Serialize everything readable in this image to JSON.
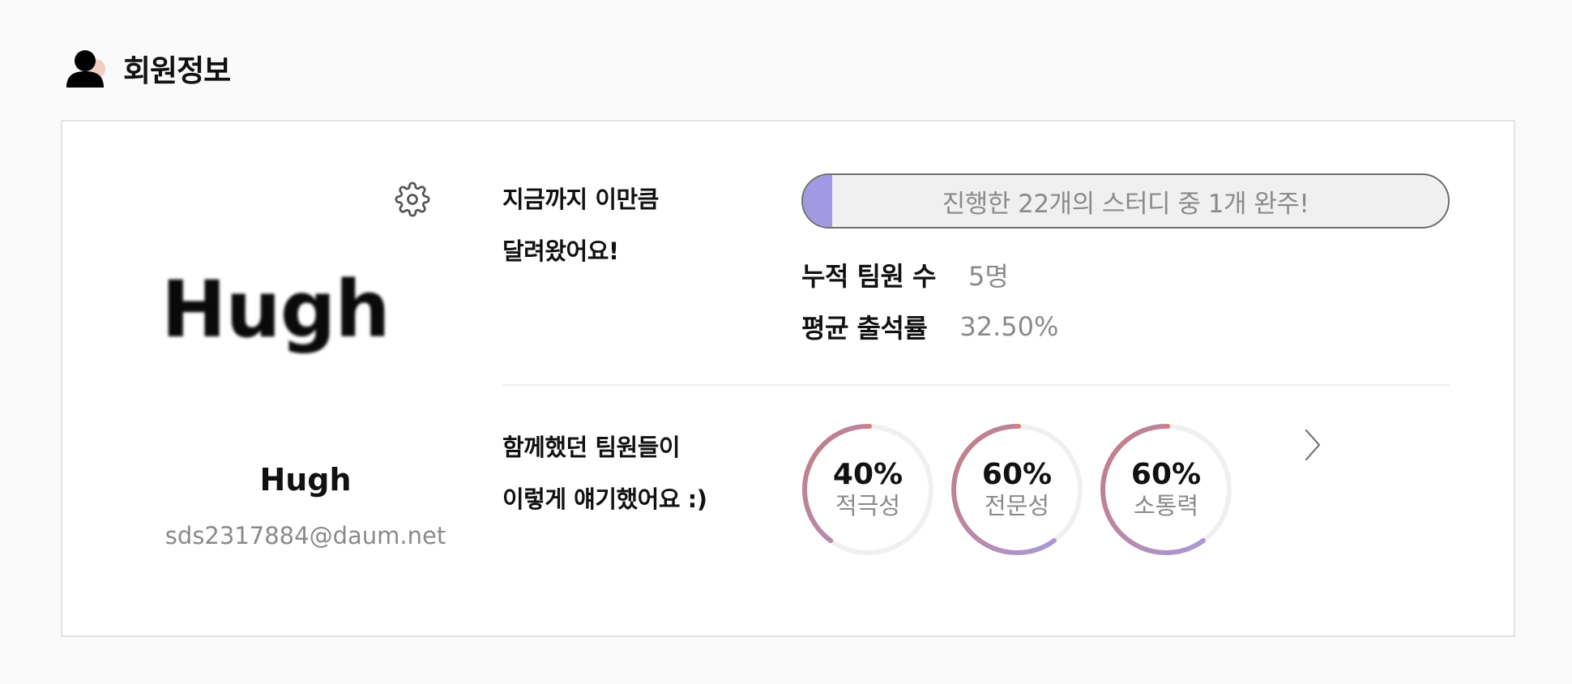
{
  "page": {
    "title": "회원정보"
  },
  "profile": {
    "image_text": "Hugh",
    "name": "Hugh",
    "email": "sds2317884@daum.net"
  },
  "summary": {
    "label_line1": "지금까지 이만큼",
    "label_line2": "달려왔어요!",
    "progress_text": "진행한 22개의 스터디 중 1개 완주!",
    "progress_fraction": 0.045,
    "stats": [
      {
        "label": "누적 팀원 수",
        "value": "5명"
      },
      {
        "label": "평균 출석률",
        "value": "32.50%"
      }
    ]
  },
  "feedback": {
    "label_line1": "함께했던 팀원들이",
    "label_line2": "이렇게 얘기했어요 :)",
    "gauges": [
      {
        "percent_text": "40%",
        "percent": 40,
        "label": "적극성"
      },
      {
        "percent_text": "60%",
        "percent": 60,
        "label": "전문성"
      },
      {
        "percent_text": "60%",
        "percent": 60,
        "label": "소통력"
      }
    ]
  },
  "colors": {
    "accent": "#a19ae3",
    "gauge_start": "#a59ee4",
    "gauge_end": "#c0808f",
    "gauge_track": "#f0f0f0",
    "muted_text": "#8a8a8a"
  },
  "icons": {
    "header": "user-icon",
    "settings": "gear-icon",
    "next": "chevron-right-icon"
  }
}
